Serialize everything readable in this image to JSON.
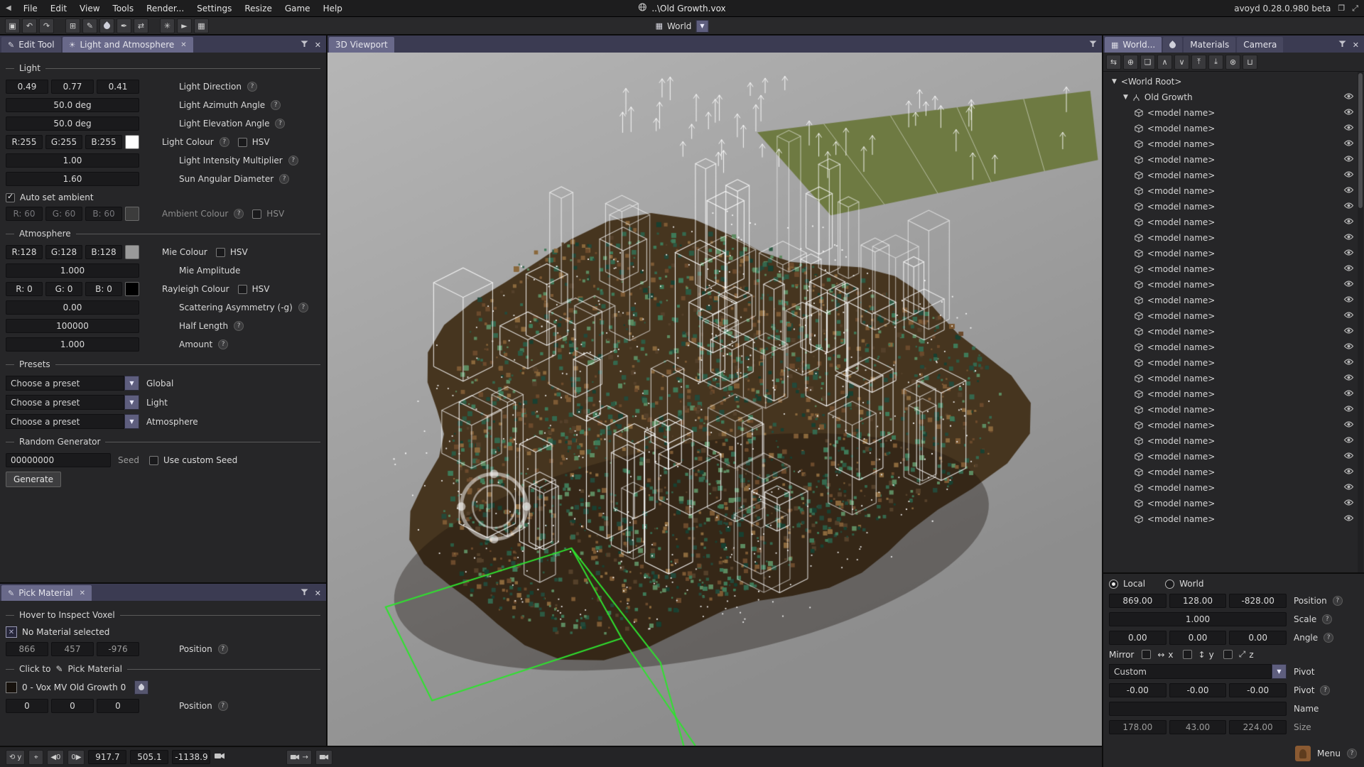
{
  "titlebar": {
    "back_glyph": "◀",
    "menus": [
      "File",
      "Edit",
      "View",
      "Tools",
      "Render...",
      "Settings",
      "Resize",
      "Game",
      "Help"
    ],
    "document": "..\\Old Growth.vox",
    "version": "avoyd 0.28.0.980 beta",
    "window_icons": [
      "❐",
      "⤢"
    ]
  },
  "toolbar": {
    "groups": [
      [
        {
          "name": "save-icon",
          "glyph": "▣"
        },
        {
          "name": "undo-icon",
          "glyph": "↶"
        },
        {
          "name": "redo-icon",
          "glyph": "↷"
        }
      ],
      [
        {
          "name": "panels-icon",
          "glyph": "⊞"
        },
        {
          "name": "edit-pencil-icon",
          "glyph": "✎"
        },
        {
          "name": "paint-drop-icon",
          "glyph": "DROP"
        },
        {
          "name": "eyedropper-icon",
          "glyph": "✒"
        },
        {
          "name": "swap-tools-icon",
          "glyph": "⇄"
        }
      ],
      [
        {
          "name": "render-icon",
          "glyph": "✳"
        },
        {
          "name": "record-icon",
          "glyph": "►"
        },
        {
          "name": "screenshot-icon",
          "glyph": "▦"
        }
      ]
    ],
    "world_selector": {
      "icon": "▦",
      "label": "World",
      "arrow": "▼"
    }
  },
  "left_panel": {
    "tabs": [
      {
        "label": "Edit Tool"
      },
      {
        "label": "Light and Atmosphere"
      }
    ],
    "light": {
      "section": "Light",
      "direction": {
        "v0": "0.49",
        "v1": "0.77",
        "v2": "0.41",
        "label": "Light Direction"
      },
      "azimuth": {
        "value": "50.0 deg",
        "label": "Light Azimuth Angle"
      },
      "elevation": {
        "value": "50.0 deg",
        "label": "Light Elevation Angle"
      },
      "colour": {
        "r": "R:255",
        "g": "G:255",
        "b": "B:255",
        "swatch": "#ffffff",
        "label": "Light Colour",
        "hsv": "HSV"
      },
      "intensity": {
        "value": "1.00",
        "label": "Light Intensity Multiplier"
      },
      "sun": {
        "value": "1.60",
        "label": "Sun Angular Diameter"
      },
      "auto_ambient": "Auto set ambient",
      "ambient": {
        "r": "R: 60",
        "g": "G: 60",
        "b": "B: 60",
        "swatch": "#3c3c3c",
        "label": "Ambient Colour",
        "hsv": "HSV"
      }
    },
    "atmosphere": {
      "section": "Atmosphere",
      "mie": {
        "r": "R:128",
        "g": "G:128",
        "b": "B:128",
        "swatch": "#9a9a9a",
        "label": "Mie Colour",
        "hsv": "HSV"
      },
      "mie_amplitude": {
        "value": "1.000",
        "label": "Mie Amplitude"
      },
      "rayleigh": {
        "r": "R: 0",
        "g": "G: 0",
        "b": "B: 0",
        "swatch": "#000000",
        "label": "Rayleigh Colour",
        "hsv": "HSV"
      },
      "scattering": {
        "value": "0.00",
        "label": "Scattering Asymmetry (-g)"
      },
      "half_length": {
        "value": "100000",
        "label": "Half Length"
      },
      "amount": {
        "value": "1.000",
        "label": "Amount"
      }
    },
    "presets": {
      "section": "Presets",
      "placeholder": "Choose a preset",
      "targets": [
        "Global",
        "Light",
        "Atmosphere"
      ]
    },
    "random": {
      "section": "Random Generator",
      "seed": "00000000",
      "seed_label": "Seed",
      "custom_seed": "Use custom Seed",
      "generate": "Generate"
    }
  },
  "pick_material": {
    "tab": "Pick Material",
    "hover_section": "Hover to Inspect Voxel",
    "no_material": "No Material selected",
    "no_material_glyph": "✕",
    "inspect_position": {
      "v0": "866",
      "v1": "457",
      "v2": "-976",
      "label": "Position"
    },
    "pick_section_pre": "Click to",
    "pick_section_icon": "✎",
    "pick_section_post": "Pick Material",
    "material_label": "0 - Vox MV Old Growth 0",
    "pick_position": {
      "v0": "0",
      "v1": "0",
      "v2": "0",
      "label": "Position"
    }
  },
  "viewport": {
    "tab": "3D Viewport"
  },
  "statusbar": {
    "axis_glyph": "⟲",
    "axis_label": "y",
    "pin_glyph": "⌖",
    "nav_left": "◀0",
    "nav_right": "0▶",
    "coords": [
      "917.7",
      "505.1",
      "-1138.9"
    ]
  },
  "right_panel": {
    "tabs": [
      {
        "label": "World...",
        "icon": "▦"
      },
      {
        "label": "",
        "icon": "DROP"
      },
      {
        "label": "Materials",
        "icon": ""
      },
      {
        "label": "Camera",
        "icon": ""
      }
    ],
    "tools": [
      {
        "name": "link-models-icon",
        "glyph": "⇆"
      },
      {
        "name": "group-models-icon",
        "glyph": "⊕"
      },
      {
        "name": "duplicate-model-icon",
        "glyph": "❏"
      },
      {
        "name": "move-up-icon",
        "glyph": "∧"
      },
      {
        "name": "move-down-icon",
        "glyph": "∨"
      },
      {
        "name": "move-to-top-icon",
        "glyph": "⤒"
      },
      {
        "name": "move-to-bottom-icon",
        "glyph": "⤓"
      },
      {
        "name": "delete-model-icon",
        "glyph": "⊗"
      },
      {
        "name": "import-model-icon",
        "glyph": "⊔"
      }
    ],
    "tree": {
      "root": "<World Root>",
      "group": "Old Growth",
      "models": [
        "<model name>",
        "<model name>",
        "<model name>",
        "<model name>",
        "<model name>",
        "<model name>",
        "<model name>",
        "<model name>",
        "<model name>",
        "<model name>",
        "<model name>",
        "<model name>",
        "<model name>",
        "<model name>",
        "<model name>",
        "<model name>",
        "<model name>",
        "<model name>",
        "<model name>",
        "<model name>",
        "<model name>",
        "<model name>",
        "<model name>",
        "<model name>",
        "<model name>",
        "<model name>",
        "<model name>"
      ]
    },
    "transform": {
      "space": {
        "local": "Local",
        "world": "World"
      },
      "position": {
        "v0": "869.00",
        "v1": "128.00",
        "v2": "-828.00",
        "label": "Position"
      },
      "scale": {
        "value": "1.000",
        "label": "Scale"
      },
      "angle": {
        "v0": "0.00",
        "v1": "0.00",
        "v2": "0.00",
        "label": "Angle"
      },
      "mirror": {
        "label": "Mirror",
        "axes": [
          {
            "glyph": "↔",
            "axis": "x"
          },
          {
            "glyph": "↕",
            "axis": "y"
          },
          {
            "glyph": "⤢",
            "axis": "z"
          }
        ]
      },
      "pivot_preset": {
        "value": "Custom",
        "label": "Pivot"
      },
      "pivot": {
        "v0": "-0.00",
        "v1": "-0.00",
        "v2": "-0.00",
        "label": "Pivot"
      },
      "name_label": "Name",
      "name_value": "",
      "size": {
        "v0": "178.00",
        "v1": "43.00",
        "v2": "224.00",
        "label": "Size"
      }
    },
    "menu_label": "Menu"
  }
}
